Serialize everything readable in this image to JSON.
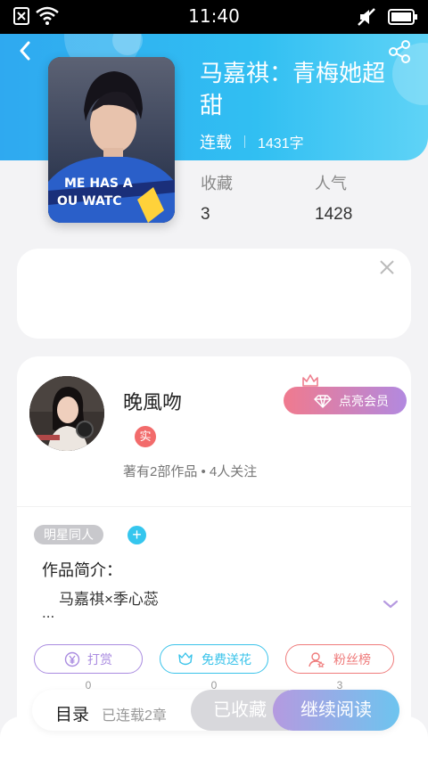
{
  "status_bar": {
    "time": "11:40",
    "icons": [
      "sim-icon",
      "wifi-icon",
      "mute-icon",
      "battery-icon"
    ]
  },
  "book": {
    "title": "马嘉祺：青梅她超甜",
    "status": "连载",
    "word_count": "1431字",
    "collect_label": "收藏",
    "collect_value": "3",
    "popularity_label": "人气",
    "popularity_value": "1428"
  },
  "author": {
    "name": "晚風吻",
    "badge": "实",
    "info": "著有2部作品 • 4人关注",
    "vip_button": "点亮会员"
  },
  "tags": [
    "明星同人"
  ],
  "intro": {
    "title": "作品简介：",
    "text": "马嘉祺×季心蕊",
    "ellipsis": "..."
  },
  "actions": [
    {
      "label": "打赏",
      "count": "0",
      "icon": "yen-icon",
      "color": "#a98be0"
    },
    {
      "label": "免费送花",
      "count": "0",
      "icon": "flower-icon",
      "color": "#3ac3ea"
    },
    {
      "label": "粉丝榜",
      "count": "3",
      "icon": "fans-icon",
      "color": "#ef7b7b"
    }
  ],
  "bottom": {
    "toc": "目录",
    "progress": "已连载2章",
    "collected": "已收藏",
    "continue": "继续阅读"
  },
  "colors": {
    "header": "#31b8f2",
    "accent": "#35c6ee"
  }
}
